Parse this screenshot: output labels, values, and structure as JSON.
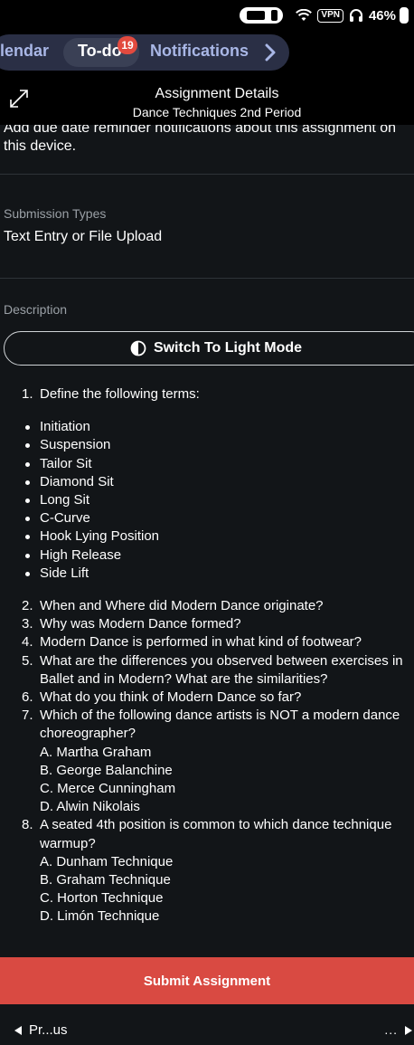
{
  "status_bar": {
    "vpn_label": "VPN",
    "battery": "46%"
  },
  "tabs": {
    "calendar": "lendar",
    "todo": "To-do",
    "todo_badge": "19",
    "notifications": "Notifications"
  },
  "header": {
    "title": "Assignment Details",
    "subtitle": "Dance Techniques 2nd Period"
  },
  "reminder": {
    "line1": "Add due date reminder notifications about this assignment on",
    "line2": "this device."
  },
  "submission": {
    "label": "Submission Types",
    "value": "Text Entry or File Upload"
  },
  "description": {
    "label": "Description",
    "mode_button": "Switch To Light Mode",
    "q1": {
      "num": "1.",
      "text": "Define the following terms:"
    },
    "terms": [
      "Initiation",
      "Suspension",
      "Tailor Sit",
      "Diamond Sit",
      "Long Sit",
      "C-Curve",
      "Hook Lying Position",
      "High Release",
      "Side Lift"
    ],
    "questions": [
      {
        "num": "2.",
        "lines": [
          "When and Where did Modern Dance originate?"
        ]
      },
      {
        "num": "3.",
        "lines": [
          "Why was Modern Dance formed?"
        ]
      },
      {
        "num": "4.",
        "lines": [
          "Modern Dance is performed in what kind of footwear?"
        ]
      },
      {
        "num": "5.",
        "lines": [
          "What are the differences you observed between exercises in",
          "Ballet and in Modern? What are the similarities?"
        ]
      },
      {
        "num": "6.",
        "lines": [
          "What do you think of Modern Dance so far?"
        ]
      },
      {
        "num": "7.",
        "lines": [
          "Which of the following dance artists is NOT a modern dance",
          "choreographer?",
          "A. Martha Graham",
          "B. George Balanchine",
          "C. Merce Cunningham",
          "D. Alwin Nikolais"
        ]
      },
      {
        "num": "8.",
        "lines": [
          "A seated 4th position is common to which dance technique",
          "warmup?",
          "A. Dunham Technique",
          "B. Graham Technique",
          "C. Horton Technique",
          "D. Limón Technique"
        ]
      }
    ]
  },
  "actions": {
    "submit": "Submit Assignment",
    "previous": "Pr...us",
    "more": "..."
  },
  "colors": {
    "accent_submit": "#d94a42",
    "badge": "#e24a3f",
    "tab_text": "#a9b7e6"
  }
}
